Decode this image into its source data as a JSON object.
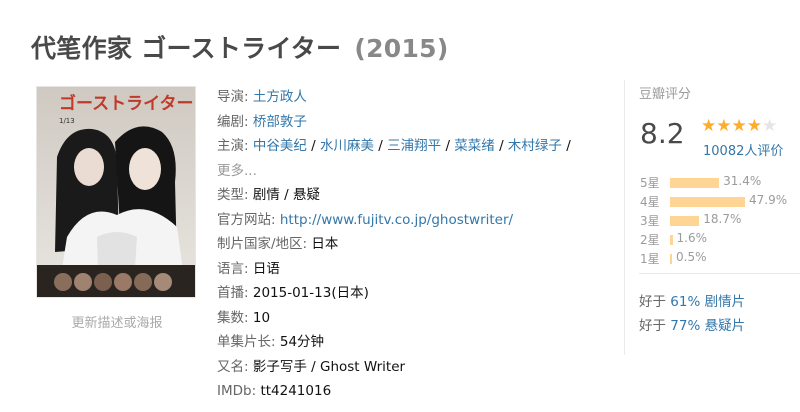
{
  "title": {
    "name": "代笔作家 ゴーストライター",
    "year": "(2015)"
  },
  "poster": {
    "heading": "ゴーストライター",
    "date_line": "1/13",
    "link": "更新描述或海报"
  },
  "info": {
    "director_label": "导演:",
    "director": "土方政人",
    "writer_label": "编剧:",
    "writer": "桥部敦子",
    "cast_label": "主演:",
    "cast": [
      "中谷美纪",
      "水川麻美",
      "三浦翔平",
      "菜菜绪",
      "木村绿子"
    ],
    "cast_more": "更多...",
    "genre_label": "类型:",
    "genre": "剧情 / 悬疑",
    "site_label": "官方网站:",
    "site": "http://www.fujitv.co.jp/ghostwriter/",
    "country_label": "制片国家/地区:",
    "country": "日本",
    "lang_label": "语言:",
    "lang": "日语",
    "premiere_label": "首播:",
    "premiere": "2015-01-13(日本)",
    "episodes_label": "集数:",
    "episodes": "10",
    "runtime_label": "单集片长:",
    "runtime": "54分钟",
    "aka_label": "又名:",
    "aka": "影子写手 / Ghost Writer",
    "imdb_label": "IMDb:",
    "imdb": "tt4241016"
  },
  "rating": {
    "label": "豆瓣评分",
    "score": "8.2",
    "stars_filled": 4,
    "votes": "10082人评价",
    "distribution": [
      {
        "label": "5星",
        "pct": "31.4%",
        "value": 31.4
      },
      {
        "label": "4星",
        "pct": "47.9%",
        "value": 47.9
      },
      {
        "label": "3星",
        "pct": "18.7%",
        "value": 18.7
      },
      {
        "label": "2星",
        "pct": "1.6%",
        "value": 1.6
      },
      {
        "label": "1星",
        "pct": "0.5%",
        "value": 0.5
      }
    ],
    "better_prefix": "好于",
    "better": [
      {
        "pct": "61%",
        "genre": "剧情片"
      },
      {
        "pct": "77%",
        "genre": "悬疑片"
      }
    ]
  },
  "colors": {
    "link": "#3377aa",
    "star": "#ffac2d",
    "bar": "#ffd596"
  }
}
